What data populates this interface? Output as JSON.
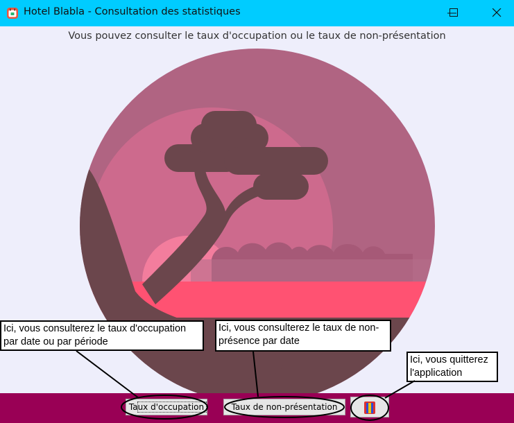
{
  "window": {
    "title": "Hotel Blabla - Consultation des statistiques"
  },
  "header": {
    "subtitle": "Vous pouvez consulter le taux d'occupation ou le taux de non-présentation"
  },
  "callouts": {
    "occupation": [
      "Ici, vous consulterez le taux d'occupation",
      "par date ou par période"
    ],
    "non_presentation": [
      "Ici, vous consulterez le taux de non-",
      "présence par date"
    ],
    "quit": [
      "Ici, vous quitterez",
      "l'application"
    ]
  },
  "toolbar": {
    "occupation_label": "Taux d'occupation",
    "non_presentation_label": "Taux de non-présentation"
  },
  "colors": {
    "titlebar": "#00ccff",
    "bottombar": "#990055",
    "background": "#eeeefb"
  }
}
